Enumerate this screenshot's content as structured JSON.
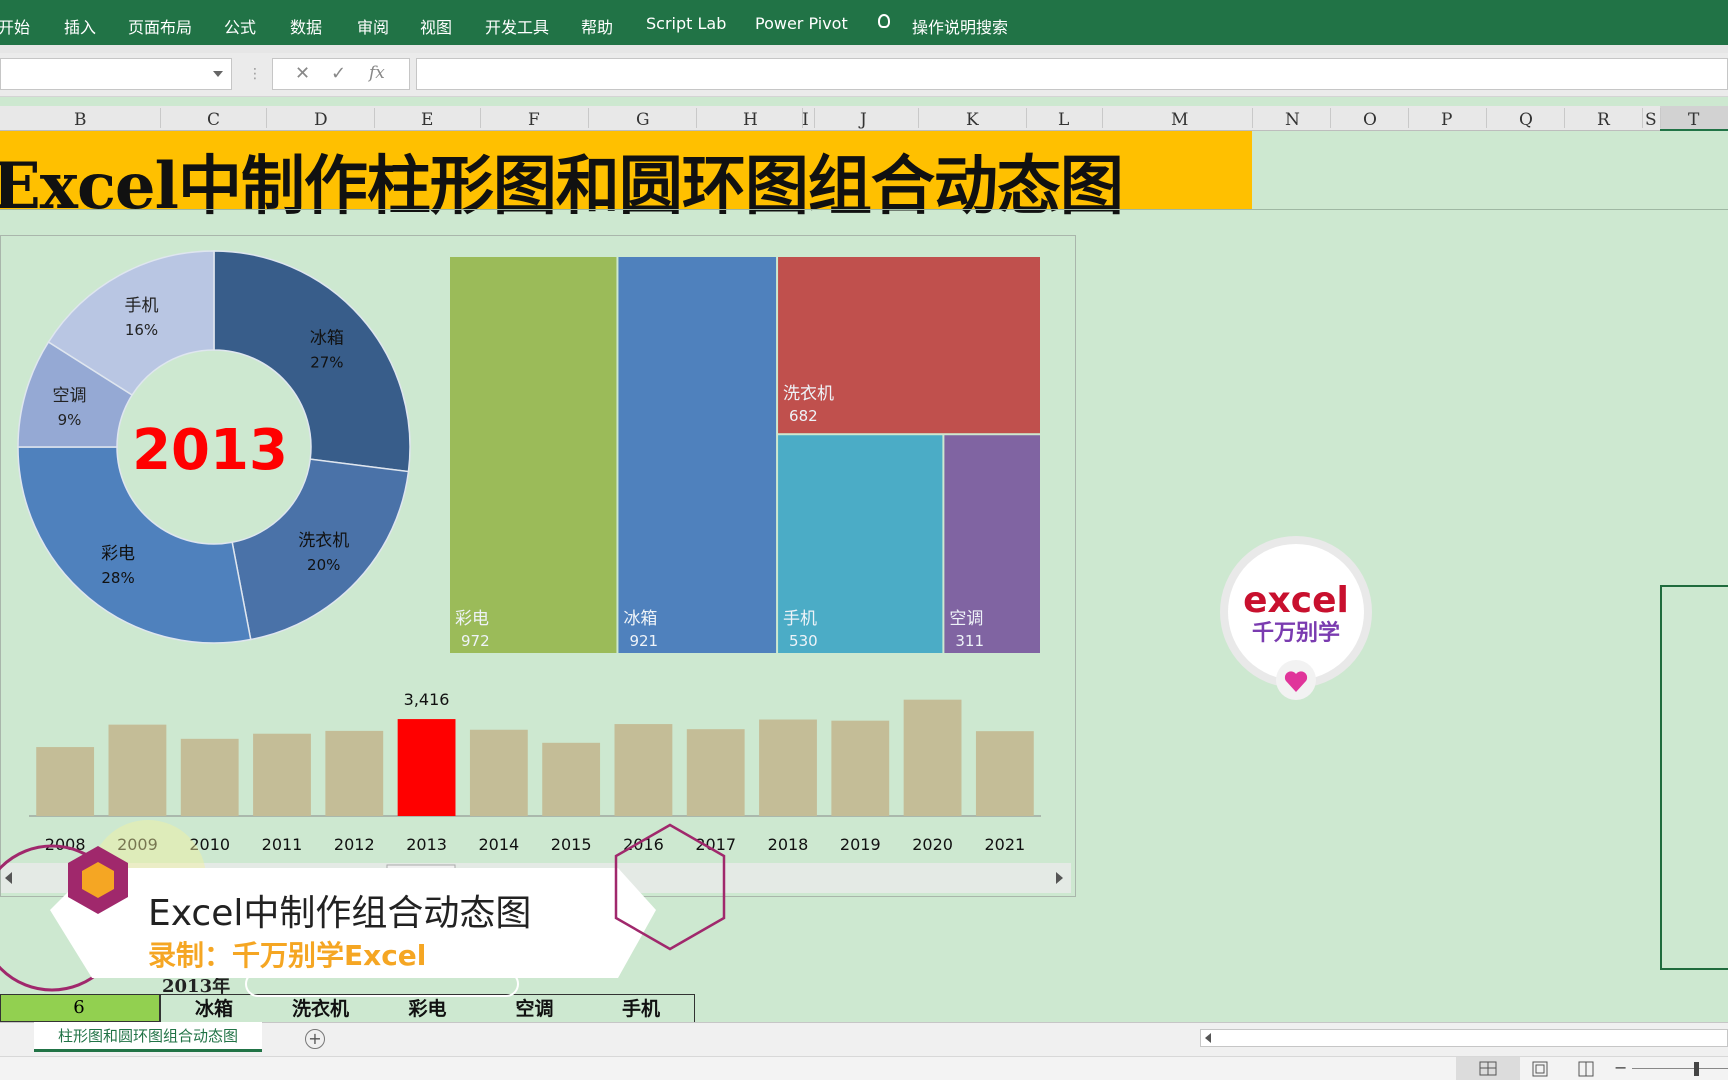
{
  "ribbon": {
    "tabs": [
      "开始",
      "插入",
      "页面布局",
      "公式",
      "数据",
      "审阅",
      "视图",
      "开发工具",
      "帮助",
      "Script Lab",
      "Power Pivot",
      "操作说明搜索"
    ]
  },
  "formula_bar": {
    "cancel": "✕",
    "enter": "✓",
    "fx": "fx"
  },
  "columns": [
    "B",
    "C",
    "D",
    "E",
    "F",
    "G",
    "H",
    "I",
    "J",
    "K",
    "L",
    "M",
    "N",
    "O",
    "P",
    "Q",
    "R",
    "S",
    "T"
  ],
  "sheet_title": "Excel中制作柱形图和圆环图组合动态图",
  "chart_data": [
    {
      "type": "pie",
      "center_label": "2013",
      "categories": [
        "冰箱",
        "洗衣机",
        "彩电",
        "空调",
        "手机"
      ],
      "labels": [
        "27%",
        "20%",
        "28%",
        "9%",
        "16%"
      ],
      "values": [
        27,
        20,
        28,
        9,
        16
      ],
      "colors": [
        "#385d8a",
        "#4a72a8",
        "#4f81bd",
        "#95a9d4",
        "#b9c6e3"
      ]
    },
    {
      "type": "treemap",
      "categories": [
        "彩电",
        "冰箱",
        "洗衣机",
        "手机",
        "空调"
      ],
      "values": [
        972,
        921,
        682,
        530,
        311
      ],
      "colors": [
        "#9bbb59",
        "#4f81bd",
        "#c0504d",
        "#4bacc6",
        "#8064a2"
      ]
    },
    {
      "type": "bar",
      "categories": [
        "2008",
        "2009",
        "2010",
        "2011",
        "2012",
        "2013",
        "2014",
        "2015",
        "2016",
        "2017",
        "2018",
        "2019",
        "2020",
        "2021"
      ],
      "values": [
        2430,
        3220,
        2720,
        2900,
        3000,
        3416,
        3040,
        2580,
        3240,
        3060,
        3400,
        3360,
        4100,
        2990
      ],
      "highlight_index": 5,
      "highlight_label": "3,416",
      "bar_color": "#c4bd97",
      "highlight_color": "#ff0000",
      "ylim": [
        0,
        4300
      ]
    }
  ],
  "logo": {
    "top": "excel",
    "bottom": "千万别学"
  },
  "watermark": {
    "line1": "Excel中制作组合动态图",
    "line2": "录制：千万别学Excel"
  },
  "table": {
    "year": "2013年",
    "index": "6",
    "headers": [
      "冰箱",
      "洗衣机",
      "彩电",
      "空调",
      "手机"
    ]
  },
  "sheet_tabs": [
    "柱形图和圆环图组合动态图"
  ],
  "add_sheet": "+",
  "scroll_handle": "|||",
  "status": {
    "zoom_minus": "−"
  }
}
